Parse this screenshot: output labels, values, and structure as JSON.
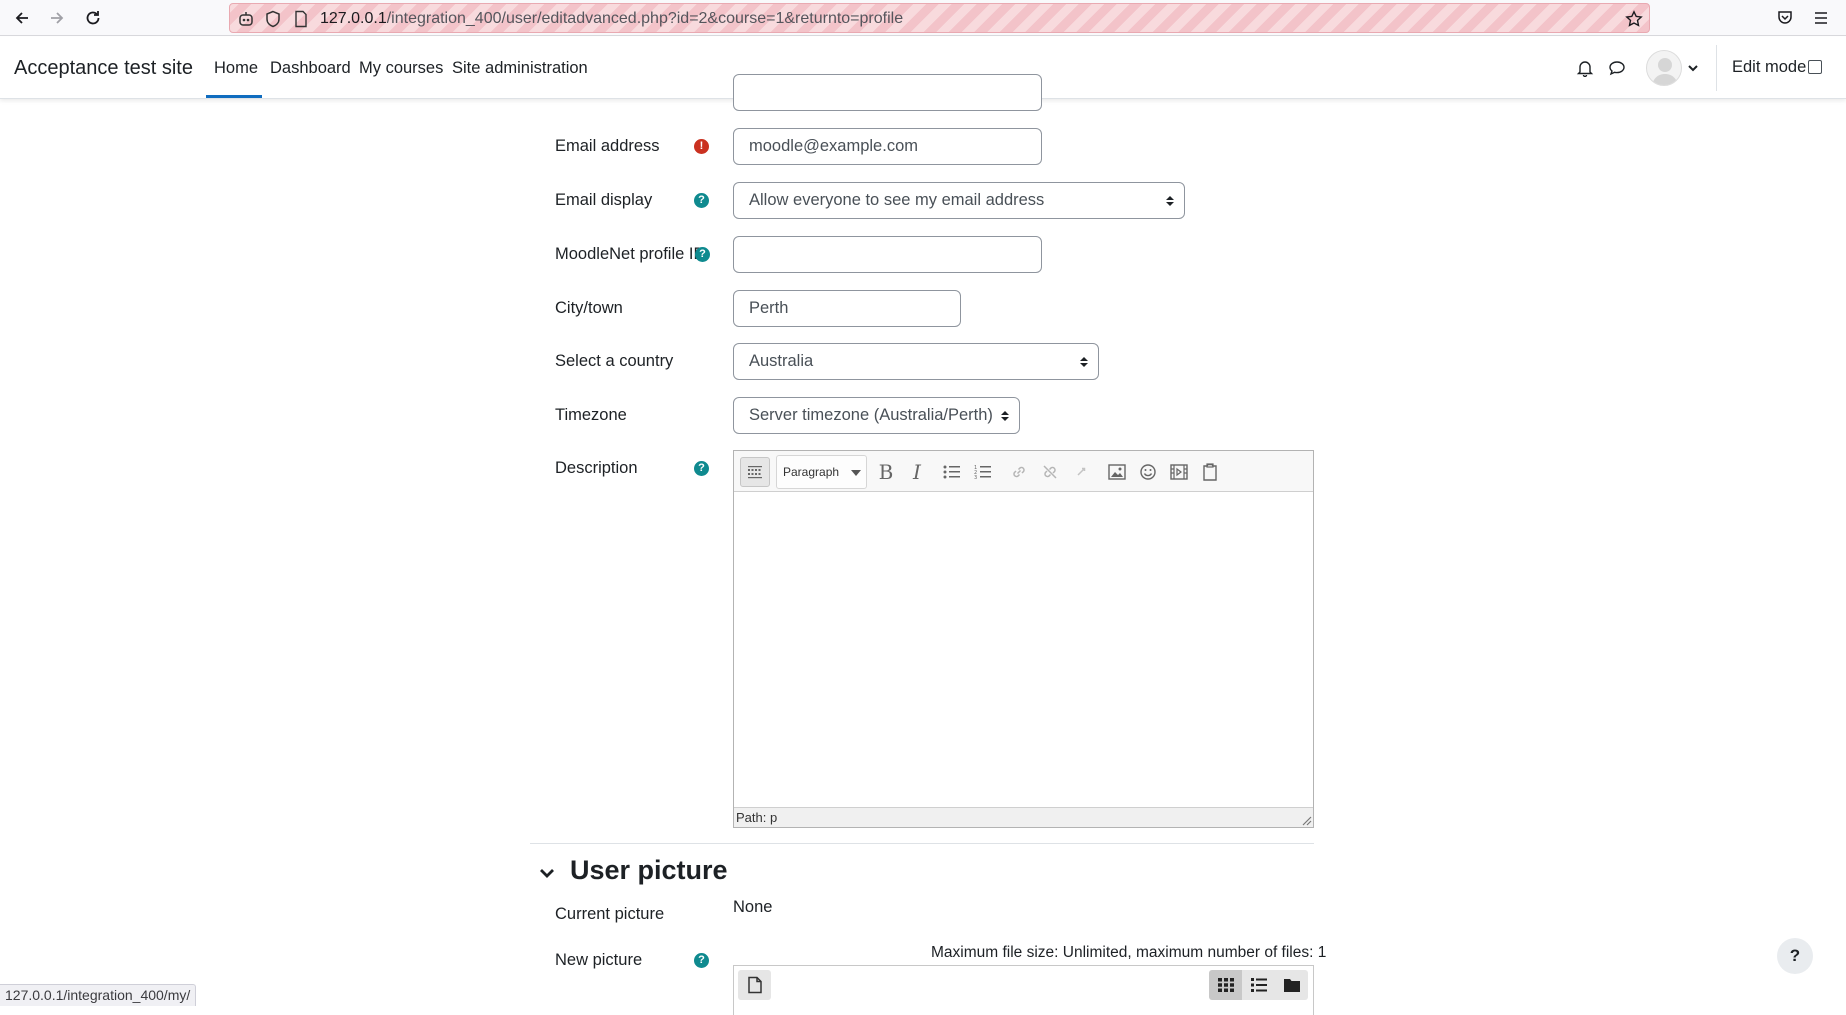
{
  "browser": {
    "url_host": "127.0.0.1",
    "url_path": "/integration_400/user/editadvanced.php?id=2&course=1&returnto=profile",
    "status_url": "127.0.0.1/integration_400/my/"
  },
  "navbar": {
    "site_name": "Acceptance test site",
    "items": [
      {
        "label": "Home",
        "active": true
      },
      {
        "label": "Dashboard"
      },
      {
        "label": "My courses"
      },
      {
        "label": "Site administration"
      }
    ],
    "edit_mode_label": "Edit mode"
  },
  "form": {
    "email": {
      "label": "Email address",
      "value": "moodle@example.com"
    },
    "email_display": {
      "label": "Email display",
      "value": "Allow everyone to see my email address"
    },
    "moodlenet": {
      "label": "MoodleNet profile ID",
      "value": ""
    },
    "city": {
      "label": "City/town",
      "value": "Perth"
    },
    "country": {
      "label": "Select a country",
      "value": "Australia"
    },
    "timezone": {
      "label": "Timezone",
      "value": "Server timezone (Australia/Perth)"
    },
    "description": {
      "label": "Description",
      "paragraph_format": "Paragraph",
      "path_text": "Path: p"
    }
  },
  "user_picture": {
    "title": "User picture",
    "current_label": "Current picture",
    "current_value": "None",
    "new_label": "New picture",
    "max_size_text": "Maximum file size: Unlimited, maximum number of files: 1"
  },
  "help_fab": "?",
  "colors": {
    "accent": "#0f6cbf",
    "help": "#0f8a8f",
    "required": "#ca3120"
  }
}
